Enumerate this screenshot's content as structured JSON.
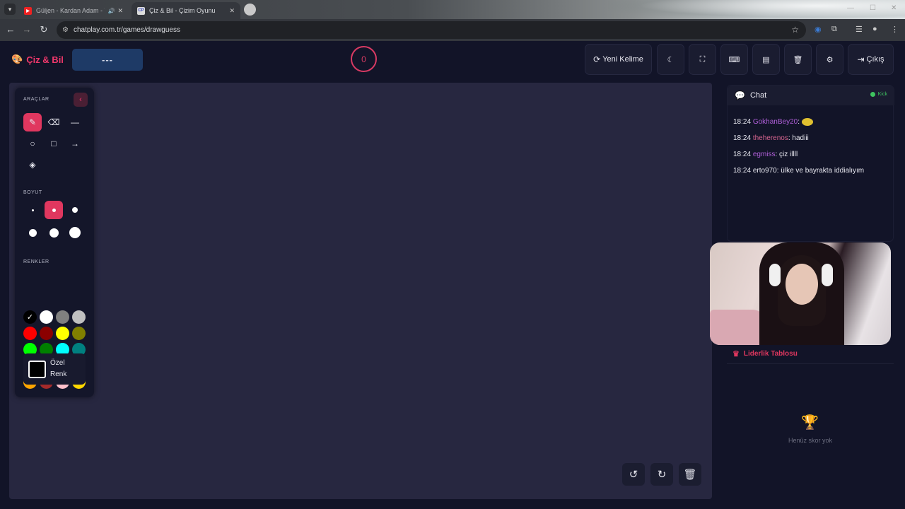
{
  "browser": {
    "tab_inactive_title": "Güljen - Kardan Adam - Yi",
    "tab_active_title": "Çiz & Bil - Çizim Oyunu",
    "url": "chatplay.com.tr/games/drawguess"
  },
  "header": {
    "logo_text": "Çiz & Bil",
    "word": "---",
    "timer": "0",
    "new_word_label": "Yeni Kelime",
    "exit_label": "Çıkış"
  },
  "tools": {
    "section_tools": "ARAÇLAR",
    "section_size": "BOYUT",
    "section_colors": "RENKLER",
    "custom_color_label": "Özel Renk",
    "colors": [
      "#000000",
      "#ffffff",
      "#808080",
      "#c0c0c0",
      "#ff0000",
      "#8b0000",
      "#ffff00",
      "#808000",
      "#00ff00",
      "#008000",
      "#00ffff",
      "#008080",
      "#0000ff",
      "#000080",
      "#ff00ff",
      "#800080",
      "#ffa500",
      "#a52a2a",
      "#ffc0cb",
      "#ffd700"
    ],
    "selected_color": "#000000",
    "selected_tool": "brush",
    "selected_size": 2
  },
  "chat": {
    "title": "Chat",
    "status": "Kick",
    "messages": [
      {
        "time": "18:24",
        "user": "GokhanBey20",
        "text": ":"
      },
      {
        "time": "18:24",
        "user": "theherenos",
        "text": ": hadiii"
      },
      {
        "time": "18:24",
        "user": "egmiss",
        "text": ": çiz illll"
      },
      {
        "time": "18:24",
        "user": "erto970",
        "text": ": ülke ve bayrakta iddialıyım"
      }
    ]
  },
  "leaderboard": {
    "title": "Liderlik Tablosu",
    "empty_text": "Henüz skor yok"
  },
  "accent_color": "#e0375f"
}
